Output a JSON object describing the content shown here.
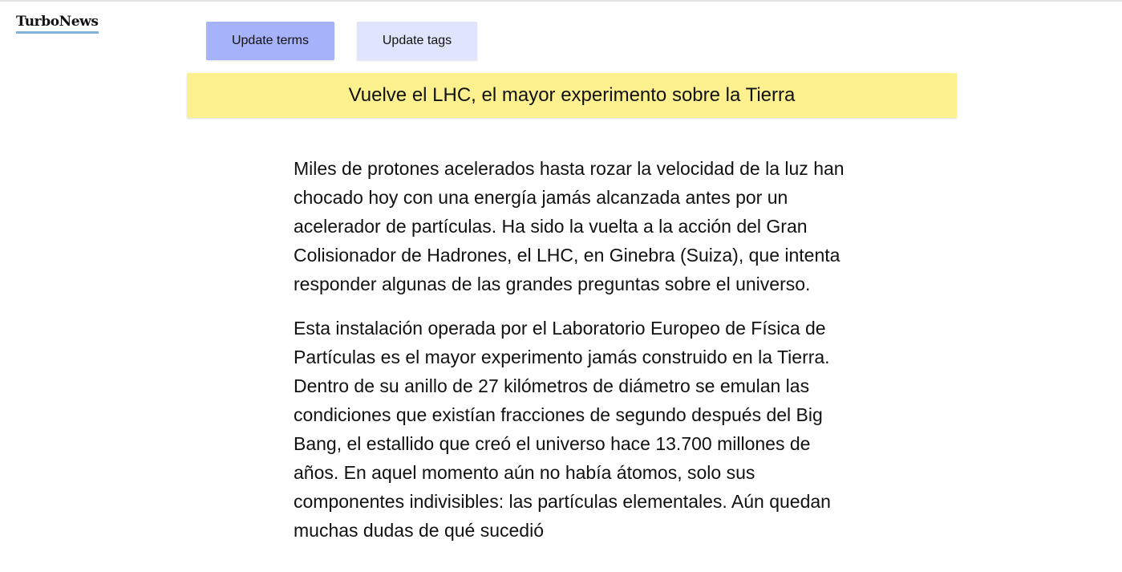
{
  "header": {
    "logo_text": "TurboNews",
    "accent_color": "#7fb2dd"
  },
  "toolbar": {
    "update_terms_label": "Update terms",
    "update_terms_color": "#a6b2fa",
    "update_tags_label": "Update tags",
    "update_tags_color": "#e0e4fc"
  },
  "article": {
    "headline": "Vuelve el LHC, el mayor experimento sobre la Tierra",
    "headline_background": "#fdf08e",
    "paragraphs": [
      "Miles de protones acelerados hasta rozar la velocidad de la luz han chocado hoy con una energía jamás alcanzada antes por un acelerador de partículas. Ha sido la vuelta a la acción del Gran Colisionador de Hadrones, el LHC, en Ginebra (Suiza), que intenta responder algunas de las grandes preguntas sobre el universo.",
      "Esta instalación operada por el Laboratorio Europeo de Física de Partículas es el mayor experimento jamás construido en la Tierra. Dentro de su anillo de 27 kilómetros de diámetro se emulan las condiciones que existían fracciones de segundo después del Big Bang, el estallido que creó el universo hace 13.700 millones de años. En aquel momento aún no había átomos, solo sus componentes indivisibles: las partículas elementales. Aún quedan muchas dudas de qué sucedió"
    ]
  }
}
